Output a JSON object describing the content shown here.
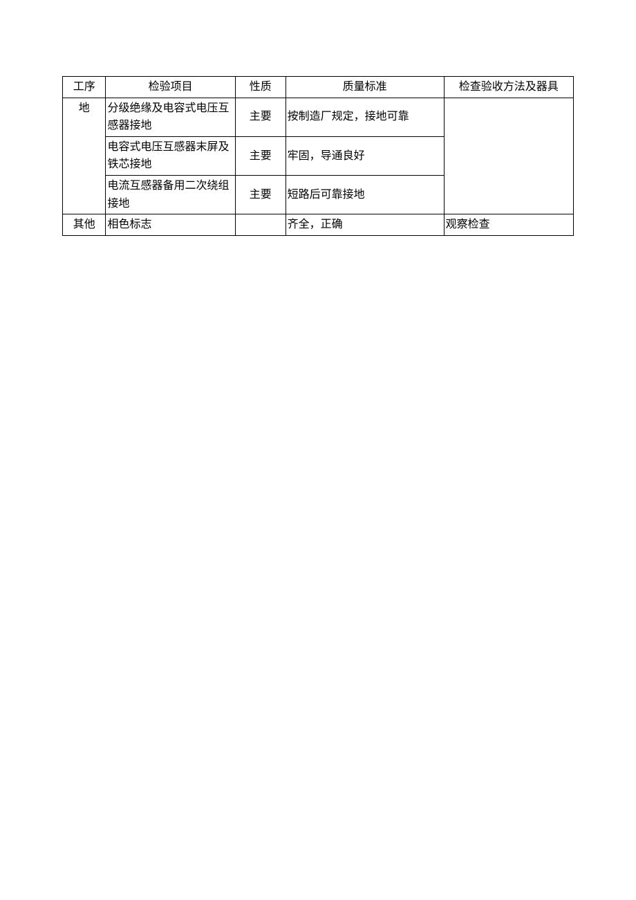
{
  "headers": {
    "col1": "工序",
    "col2": "检验项目",
    "col3": "性质",
    "col4": "质量标准",
    "col5": "检查验收方法及器具"
  },
  "rows": [
    {
      "col1": "地",
      "col2": "分级绝缘及电容式电压互感器接地",
      "col3": "主要",
      "col4": "按制造厂规定，接地可靠",
      "col5": ""
    },
    {
      "col2": "电容式电压互感器末屏及铁芯接地",
      "col3": "主要",
      "col4": "牢固，导通良好"
    },
    {
      "col2": "电流互感器备用二次绕组接地",
      "col3": "主要",
      "col4": "短路后可靠接地"
    },
    {
      "col1": "其他",
      "col2": "相色标志",
      "col3": "",
      "col4": "齐全，正确",
      "col5": "观察检查"
    }
  ]
}
